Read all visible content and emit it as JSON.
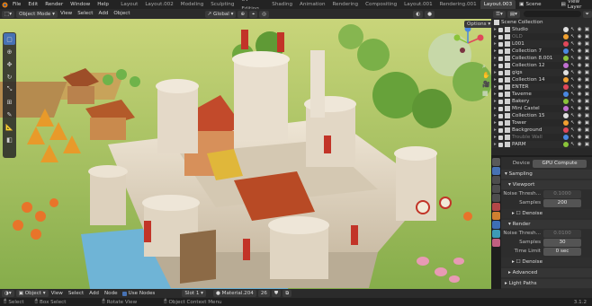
{
  "menu": [
    "File",
    "Edit",
    "Render",
    "Window",
    "Help"
  ],
  "workspaces": [
    "Layout",
    "Layout.002",
    "Modeling",
    "Sculpting",
    "UV Editing",
    "Shading",
    "Animation",
    "Rendering",
    "Compositing",
    "Layout.001",
    "Rendering.001",
    "Layout.003"
  ],
  "active_workspace": "Layout.003",
  "scene": "Scene",
  "view_layer": "View Layer",
  "viewport_header": {
    "mode": "Object Mode",
    "menus": [
      "View",
      "Select",
      "Add",
      "Object"
    ],
    "orientation": "Global",
    "options": "Options"
  },
  "outliner": {
    "root": "Scene Collection",
    "items": [
      {
        "name": "Studio",
        "dim": false
      },
      {
        "name": "OLD",
        "dim": true
      },
      {
        "name": "L001",
        "dim": false
      },
      {
        "name": "Collection 7",
        "dim": false
      },
      {
        "name": "Collection 8.001",
        "dim": false
      },
      {
        "name": "Collection 12",
        "dim": false
      },
      {
        "name": "gigs",
        "dim": false
      },
      {
        "name": "Collection 14",
        "dim": false
      },
      {
        "name": "ENTER",
        "dim": false
      },
      {
        "name": "Taverne",
        "dim": false
      },
      {
        "name": "Bakery",
        "dim": false
      },
      {
        "name": "Mini Castel",
        "dim": false
      },
      {
        "name": "Collection 15",
        "dim": false
      },
      {
        "name": "Tower",
        "dim": false
      },
      {
        "name": "Background",
        "dim": false
      },
      {
        "name": "Trouble Wall",
        "dim": true
      },
      {
        "name": "PARM",
        "dim": false
      }
    ]
  },
  "properties": {
    "device_label": "Device",
    "device_value": "GPU Compute",
    "sampling": "Sampling",
    "viewport": "Viewport",
    "noise_threshold_label": "Noise Thresh...",
    "viewport_noise_value": "0.1000",
    "samples_label": "Samples",
    "viewport_samples": "200",
    "denoise": "Denoise",
    "render": "Render",
    "render_noise_value": "0.0100",
    "render_samples": "30",
    "time_limit_label": "Time Limit",
    "time_limit_value": "0 sec",
    "advanced": "Advanced",
    "light_paths": "Light Paths"
  },
  "node_header": {
    "type": "Object",
    "menus": [
      "View",
      "Select",
      "Add",
      "Node"
    ],
    "use_nodes": "Use Nodes",
    "slot": "Slot 1",
    "material": "Material.204",
    "users": "26"
  },
  "status": {
    "items": [
      "Select",
      "Box Select",
      "Rotate View",
      "Object Context Menu"
    ],
    "version": "3.1.2"
  },
  "colors": {
    "accent": "#4772b3",
    "grass": "#9bbf5a",
    "stone": "#e4d9c8",
    "roof": "#c24a2b",
    "water": "#6fb4d6"
  }
}
